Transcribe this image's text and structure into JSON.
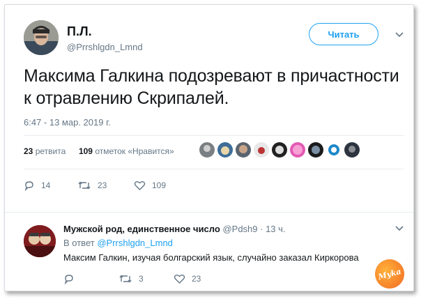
{
  "tweet": {
    "author_name": "П.Л.",
    "author_handle": "@Prrshlgdn_Lmnd",
    "follow_label": "Читать",
    "text": "Максима Галкина подозревают в причастности к отравлению Скрипалей.",
    "timestamp": "6:47 - 13 мар. 2019 г.",
    "retweets_count": "23",
    "retweets_label": "ретвита",
    "likes_count": "109",
    "likes_label": "отметок «Нравится»",
    "actions": {
      "replies": "14",
      "retweets": "23",
      "likes": "109"
    }
  },
  "reply": {
    "author_name": "Мужской род, единственное число",
    "author_handle": "@Pdsh9",
    "time": "· 13 ч.",
    "reply_to_prefix": "В ответ",
    "reply_to_handle": "@Prrshlgdn_Lmnd",
    "text": "Максим Галкин, изучая болгарский язык, случайно заказал Киркорова",
    "actions": {
      "replies": "",
      "retweets": "3",
      "likes": "23"
    }
  },
  "watermark_text": "Мyka",
  "colors": {
    "accent": "#1da1f2",
    "text": "#14171a",
    "muted": "#657786",
    "border": "#e6ecf0"
  },
  "icons": [
    "chevron-down-icon",
    "reply-icon",
    "retweet-icon",
    "heart-icon"
  ]
}
